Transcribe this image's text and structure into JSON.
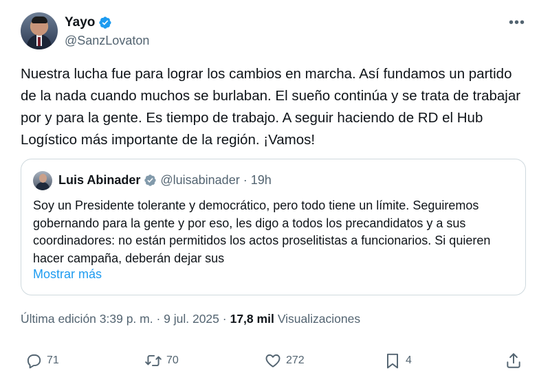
{
  "author": {
    "name": "Yayo",
    "handle": "@SanzLovaton"
  },
  "tweet": {
    "text": "Nuestra lucha fue para lograr los cambios en marcha. Así fundamos un partido de la nada cuando muchos se burlaban. El sueño continúa y se trata de trabajar por y para la gente. Es tiempo de trabajo. A seguir haciendo de RD el Hub Logístico más importante de la región. ¡Vamos!"
  },
  "quote": {
    "name": "Luis Abinader",
    "handle": "@luisabinader",
    "separator": "·",
    "time": "19h",
    "text": "Soy un Presidente tolerante y democrático, pero todo tiene un límite. Seguiremos gobernando para la gente y por eso, les digo a todos los precandidatos y a sus coordinadores: no están permitidos los actos proselitistas a funcionarios. Si quieren hacer campaña, deberán dejar sus",
    "show_more": "Mostrar más"
  },
  "meta": {
    "edited": "Última edición 3:39 p. m. · 9 jul. 2025 ·",
    "views_count": "17,8 mil",
    "views_label": "Visualizaciones"
  },
  "actions": {
    "replies": "71",
    "retweets": "70",
    "likes": "272",
    "bookmarks": "4"
  },
  "colors": {
    "accent": "#1d9bf0",
    "muted": "#536471",
    "text": "#0f1419",
    "border": "#cfd9de"
  },
  "icons": [
    "verified-badge-icon",
    "more-icon",
    "reply-icon",
    "retweet-icon",
    "like-icon",
    "bookmark-icon",
    "share-icon"
  ]
}
